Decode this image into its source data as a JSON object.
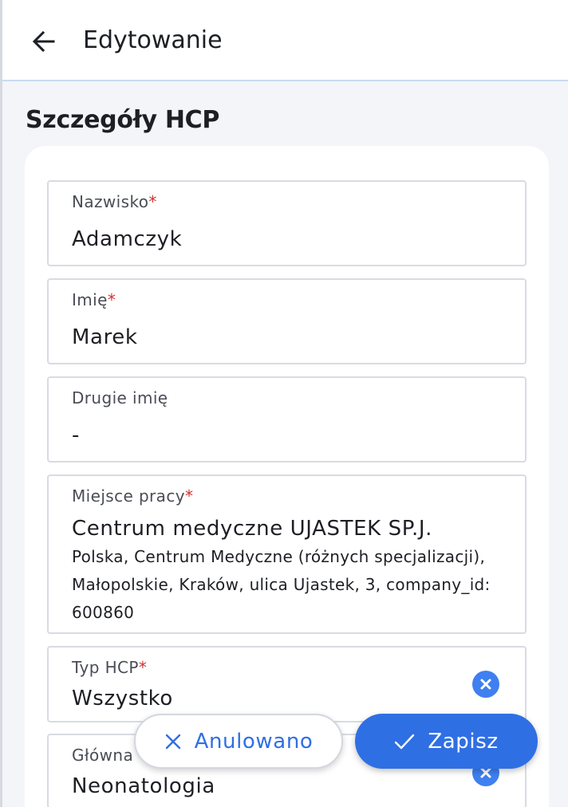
{
  "header": {
    "title": "Edytowanie",
    "back_icon": "arrow-left-icon"
  },
  "section": {
    "title": "Szczegóły HCP"
  },
  "fields": {
    "last_name": {
      "label": "Nazwisko",
      "required_mark": "*",
      "value": "Adamczyk"
    },
    "first_name": {
      "label": "Imię",
      "required_mark": "*",
      "value": "Marek"
    },
    "middle_name": {
      "label": "Drugie imię",
      "value": "-"
    },
    "workplace": {
      "label": "Miejsce pracy",
      "required_mark": "*",
      "value": "Centrum medyczne UJASTEK SP.J.",
      "details": "Polska, Centrum Medyczne (różnych specjalizacji), Małopolskie, Kraków, ulica Ujastek, 3, company_id: 600860"
    },
    "hcp_type": {
      "label": "Typ HCP",
      "required_mark": "*",
      "value": "Wszystko"
    },
    "main_specialty": {
      "label": "Główna",
      "value": "Neonatologia"
    }
  },
  "actions": {
    "cancel_label": "Anulowano",
    "save_label": "Zapisz"
  },
  "colors": {
    "accent": "#2f6fe4",
    "clear_button": "#3f7ff0",
    "required": "#d32f2f"
  }
}
